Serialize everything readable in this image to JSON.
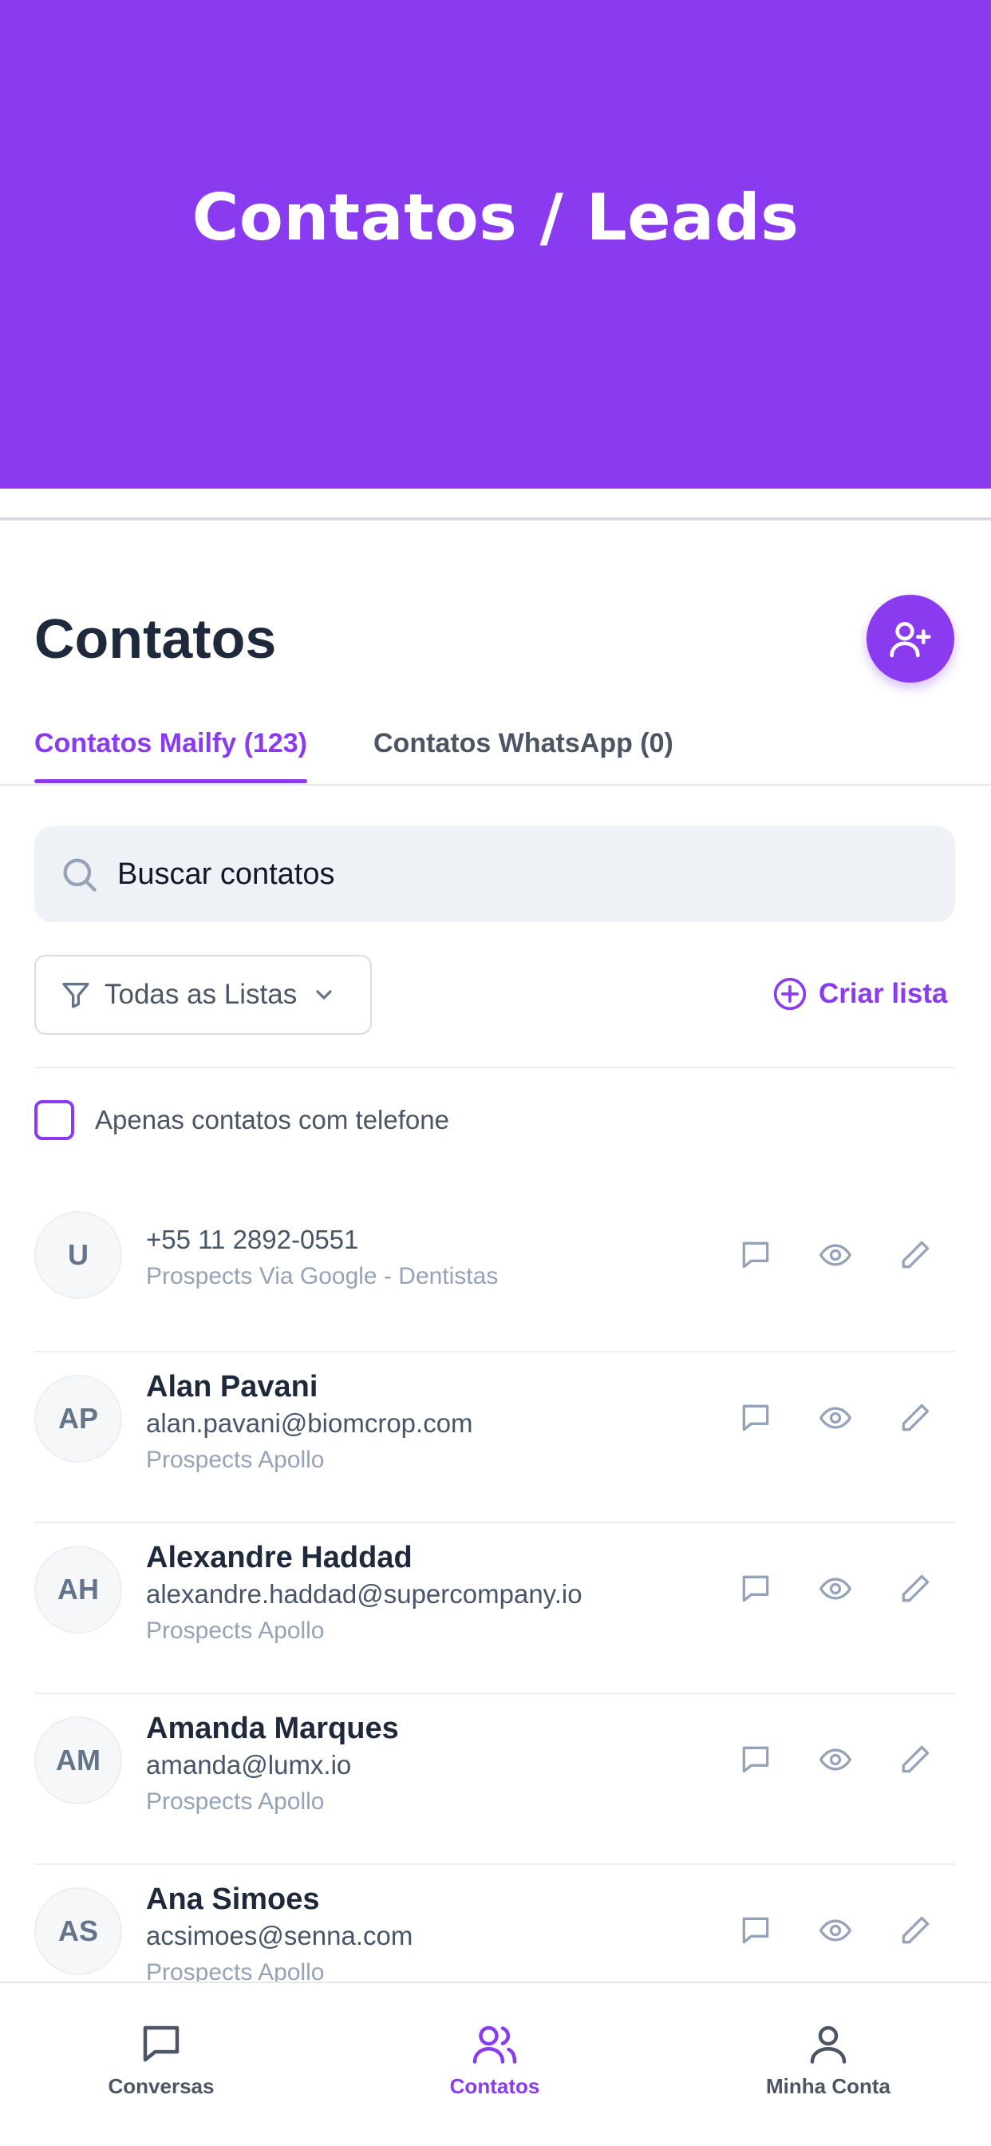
{
  "header": {
    "title": "Contatos / Leads"
  },
  "page": {
    "title": "Contatos"
  },
  "tabs": [
    {
      "label": "Contatos Mailfy (123)",
      "active": true
    },
    {
      "label": "Contatos WhatsApp (0)",
      "active": false
    }
  ],
  "search": {
    "value": "Buscar contatos"
  },
  "filter": {
    "selected": "Todas as Listas"
  },
  "create_list": {
    "label": "Criar lista"
  },
  "phone_filter": {
    "label": "Apenas contatos com telefone",
    "checked": false
  },
  "contacts": [
    {
      "initials": "U",
      "name": "",
      "email": "+55 11 2892-0551",
      "list": "Prospects Via Google - Dentistas"
    },
    {
      "initials": "AP",
      "name": "Alan Pavani",
      "email": "alan.pavani@biomcrop.com",
      "list": "Prospects Apollo"
    },
    {
      "initials": "AH",
      "name": "Alexandre Haddad",
      "email": "alexandre.haddad@supercompany.io",
      "list": "Prospects Apollo"
    },
    {
      "initials": "AM",
      "name": "Amanda Marques",
      "email": "amanda@lumx.io",
      "list": "Prospects Apollo"
    },
    {
      "initials": "AS",
      "name": "Ana Simoes",
      "email": "acsimoes@senna.com",
      "list": "Prospects Apollo"
    }
  ],
  "bottom_nav": [
    {
      "label": "Conversas",
      "icon": "chat-icon",
      "active": false
    },
    {
      "label": "Contatos",
      "icon": "users-icon",
      "active": true
    },
    {
      "label": "Minha Conta",
      "icon": "user-icon",
      "active": false
    }
  ],
  "colors": {
    "accent": "#8a3bef",
    "text": "#1e293b",
    "muted": "#94a3b8"
  }
}
